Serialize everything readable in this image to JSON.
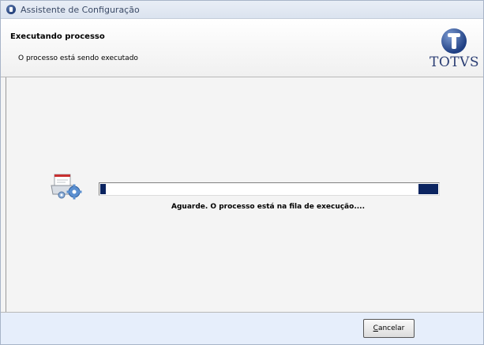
{
  "window": {
    "title": "Assistente de Configuração",
    "icon": "totvs-app-icon"
  },
  "header": {
    "title": "Executando processo",
    "subtitle": "O processo está sendo executado",
    "logo_text": "TOTVS"
  },
  "main": {
    "process_icon": "process-gear-icon",
    "progress": {
      "segments_filled": "left-and-right",
      "message": "Aguarde. O processo está na fila de execução...."
    }
  },
  "footer": {
    "cancel_access_key": "C",
    "cancel_label_rest": "ancelar"
  },
  "colors": {
    "progress_fill": "#0b2460",
    "footer_bg": "#e6eefb",
    "logo": "#2a3d73"
  }
}
